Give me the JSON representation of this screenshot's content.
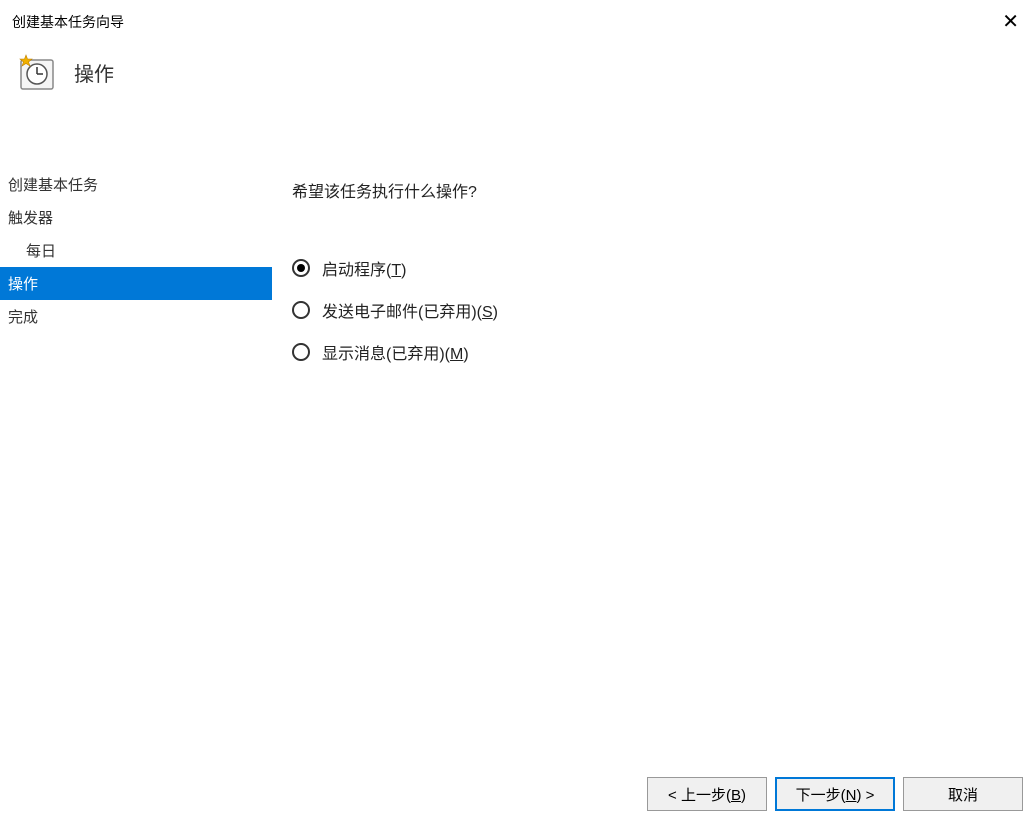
{
  "window": {
    "title": "创建基本任务向导"
  },
  "header": {
    "title": "操作"
  },
  "sidebar": {
    "items": [
      {
        "label": "创建基本任务",
        "selected": false,
        "indent": false
      },
      {
        "label": "触发器",
        "selected": false,
        "indent": false
      },
      {
        "label": "每日",
        "selected": false,
        "indent": true
      },
      {
        "label": "操作",
        "selected": true,
        "indent": false
      },
      {
        "label": "完成",
        "selected": false,
        "indent": false
      }
    ]
  },
  "main": {
    "prompt": "希望该任务执行什么操作?",
    "options": [
      {
        "label_pre": "启动程序(",
        "key": "T",
        "label_post": ")",
        "selected": true
      },
      {
        "label_pre": "发送电子邮件(已弃用)(",
        "key": "S",
        "label_post": ")",
        "selected": false
      },
      {
        "label_pre": "显示消息(已弃用)(",
        "key": "M",
        "label_post": ")",
        "selected": false
      }
    ]
  },
  "footer": {
    "back_pre": "< 上一步(",
    "back_key": "B",
    "back_post": ")",
    "next_pre": "下一步(",
    "next_key": "N",
    "next_post": ") >",
    "cancel": "取消"
  }
}
